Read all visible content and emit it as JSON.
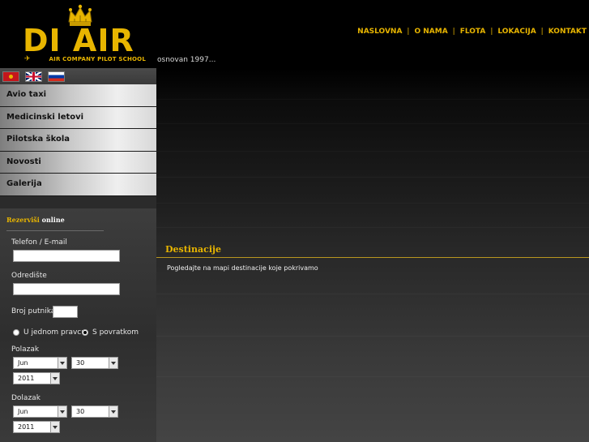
{
  "brand": {
    "name": "DI AIR",
    "subtitle": "AIR COMPANY PILOT SCHOOL",
    "tagline": "osnovan 1997..."
  },
  "topnav": {
    "items": [
      "NASLOVNA",
      "O NAMA",
      "FLOTA",
      "LOKACIJA",
      "KONTAKT"
    ],
    "separator": "|"
  },
  "languages": [
    "montenegro-flag",
    "uk-flag",
    "russia-flag"
  ],
  "menu": {
    "items": [
      "Avio taxi",
      "Medicinski letovi",
      "Pilotska škola",
      "Novosti",
      "Galerija"
    ]
  },
  "booking": {
    "title_highlight": "Rezerviši",
    "title_rest": " online",
    "phone_label": "Telefon / E-mail",
    "phone_value": "",
    "destination_label": "Odredište",
    "destination_value": "",
    "passengers_label": "Broj putnika",
    "passengers_value": "",
    "oneway_label": "U jednom pravcu",
    "return_label": "S povratkom",
    "trip_type_selected": "S povratkom",
    "departure_label": "Polazak",
    "departure_month": "Jun",
    "departure_day": "30",
    "departure_year": "2011",
    "arrival_label": "Dolazak",
    "arrival_month": "Jun",
    "arrival_day": "30",
    "arrival_year": "2011"
  },
  "content": {
    "heading": "Destinacije",
    "text": "Pogledajte na mapi destinacije koje pokrivamo"
  },
  "colors": {
    "accent": "#e8b500",
    "background": "#000000",
    "panel": "#2b2b2b"
  }
}
